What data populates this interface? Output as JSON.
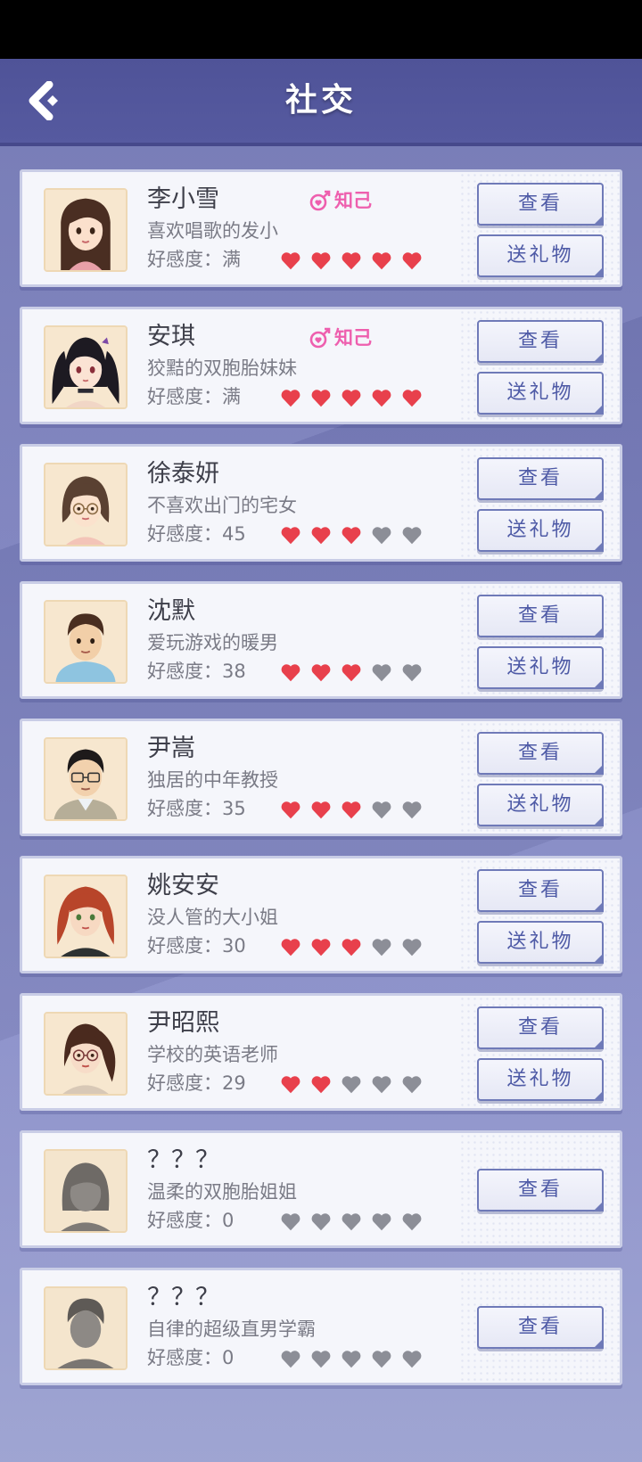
{
  "header": {
    "title": "社交"
  },
  "colors": {
    "heart_full": "#e8404c",
    "heart_empty": "#8c8e97",
    "relation": "#ee5fae"
  },
  "characters": [
    {
      "name": "李小雪",
      "desc": "喜欢唱歌的发小",
      "affection": "好感度：满",
      "hearts_filled": 5,
      "relation": "知己",
      "view_label": "查看",
      "gift_label": "送礼物",
      "avatar": "avatar-girl-long-hair"
    },
    {
      "name": "安琪",
      "desc": "狡黠的双胞胎妹妹",
      "affection": "好感度：满",
      "hearts_filled": 5,
      "relation": "知己",
      "view_label": "查看",
      "gift_label": "送礼物",
      "avatar": "avatar-girl-twintails"
    },
    {
      "name": "徐泰妍",
      "desc": "不喜欢出门的宅女",
      "affection": "好感度：45",
      "hearts_filled": 3,
      "view_label": "查看",
      "gift_label": "送礼物",
      "avatar": "avatar-girl-glasses-bob"
    },
    {
      "name": "沈默",
      "desc": "爱玩游戏的暖男",
      "affection": "好感度：38",
      "hearts_filled": 3,
      "view_label": "查看",
      "gift_label": "送礼物",
      "avatar": "avatar-boy-hoodie"
    },
    {
      "name": "尹嵩",
      "desc": "独居的中年教授",
      "affection": "好感度：35",
      "hearts_filled": 3,
      "view_label": "查看",
      "gift_label": "送礼物",
      "avatar": "avatar-man-glasses"
    },
    {
      "name": "姚安安",
      "desc": "没人管的大小姐",
      "affection": "好感度：30",
      "hearts_filled": 3,
      "view_label": "查看",
      "gift_label": "送礼物",
      "avatar": "avatar-girl-red-hair"
    },
    {
      "name": "尹昭熙",
      "desc": "学校的英语老师",
      "affection": "好感度：29",
      "hearts_filled": 2,
      "view_label": "查看",
      "gift_label": "送礼物",
      "avatar": "avatar-woman-glasses-ponytail"
    },
    {
      "name": "？？？",
      "desc": "温柔的双胞胎姐姐",
      "affection": "好感度：0",
      "hearts_filled": 0,
      "view_label": "查看",
      "avatar": "avatar-locked-girl"
    },
    {
      "name": "？？？",
      "desc": "自律的超级直男学霸",
      "affection": "好感度：0",
      "hearts_filled": 0,
      "view_label": "查看",
      "avatar": "avatar-locked-boy"
    }
  ]
}
